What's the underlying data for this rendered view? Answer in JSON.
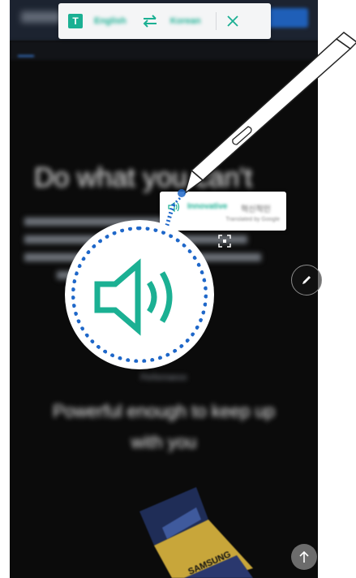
{
  "translate_bar": {
    "source_language": "English",
    "target_language": "Korean",
    "icon": "translate-t-icon",
    "swap_icon": "swap-arrows-icon",
    "close_icon": "close-icon"
  },
  "page": {
    "headline": "Do what you can't",
    "tagline_label": "Performance",
    "subheadline_line1": "Powerful enough to keep up",
    "subheadline_line2": "with you"
  },
  "popup": {
    "source_word": "Innovative",
    "translated_word": "혁신적인",
    "provider": "Translated by Google"
  },
  "colors": {
    "accent_teal": "#1bb093",
    "ring_blue": "#1e67c9",
    "page_bg": "#0b0b0b"
  },
  "icons": {
    "zoomed_speaker": "speaker-icon",
    "pencil": "pencil-icon",
    "scroll_top": "arrow-up-icon",
    "crop": "crop-icon"
  }
}
